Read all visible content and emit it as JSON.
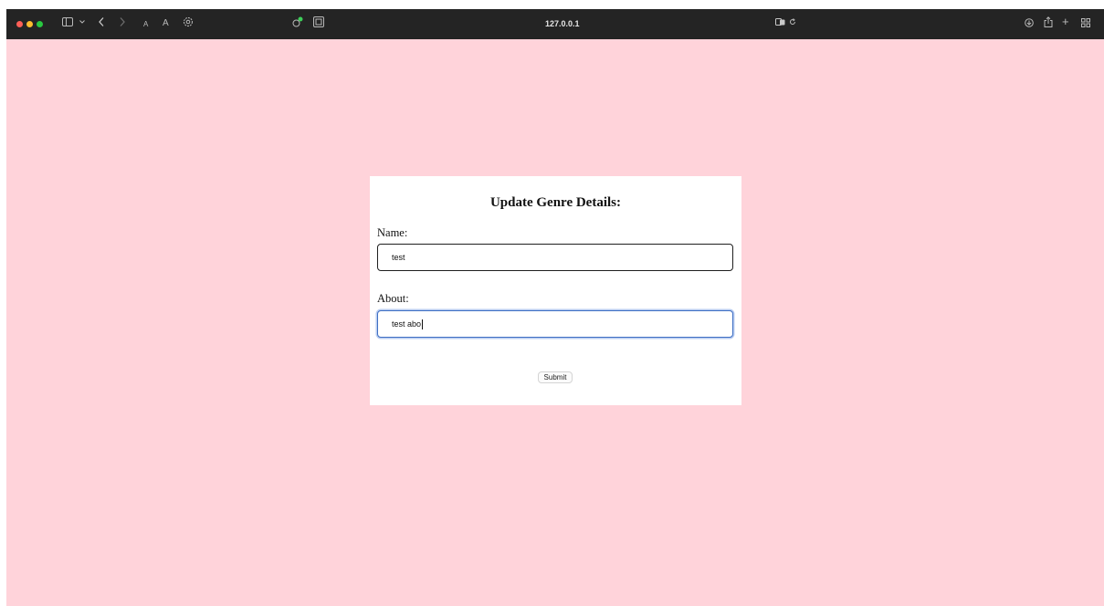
{
  "browser": {
    "address": "127.0.0.1"
  },
  "form": {
    "heading": "Update Genre Details:",
    "name_label": "Name:",
    "name_value": "test",
    "about_label": "About:",
    "about_value": "test abo",
    "submit_label": "Submit"
  },
  "colors": {
    "page_background": "#ffd3da",
    "toolbar_background": "#242424",
    "focus_ring": "#3f6fc3"
  },
  "icons": [
    "sidebar-icon",
    "chevron-down-icon",
    "back-icon",
    "forward-icon",
    "text-smaller-icon",
    "text-larger-icon",
    "settings-icon",
    "extension-icon",
    "reader-icon",
    "translate-icon",
    "reload-icon",
    "download-icon",
    "share-icon",
    "new-tab-icon",
    "tab-overview-icon"
  ]
}
